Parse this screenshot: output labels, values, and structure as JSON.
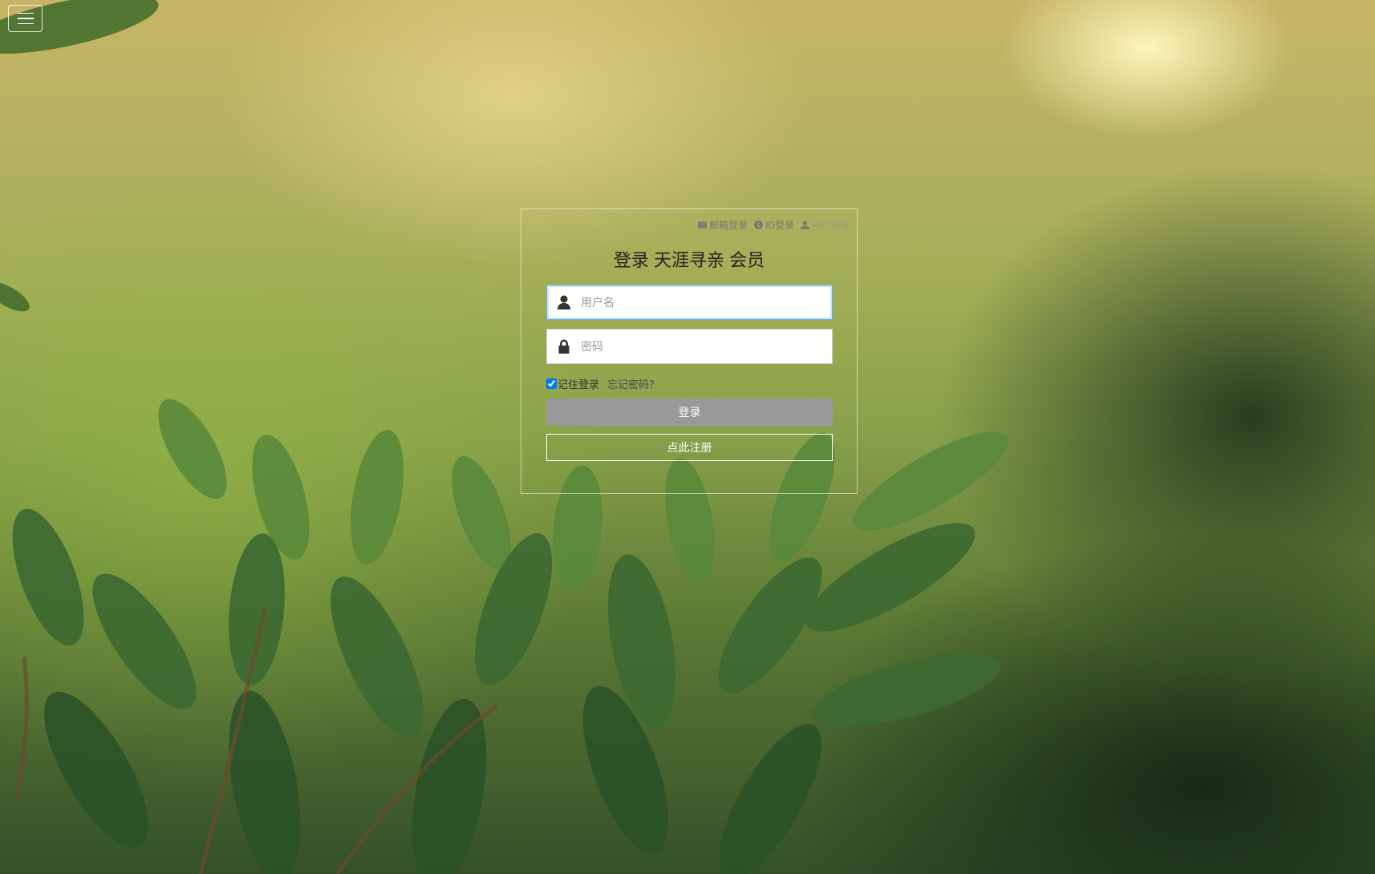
{
  "nav": {
    "menu_icon": "hamburger-menu-icon"
  },
  "login": {
    "tabs": [
      {
        "icon": "envelope-icon",
        "label": "邮箱登录"
      },
      {
        "icon": "info-circle-icon",
        "label": "ID登录"
      },
      {
        "icon": "user-icon",
        "label": "用户登录"
      }
    ],
    "title": "登录 天涯寻亲 会员",
    "username": {
      "placeholder": "用户名",
      "value": "",
      "icon": "user-icon"
    },
    "password": {
      "placeholder": "密码",
      "value": "",
      "icon": "lock-icon"
    },
    "remember_label": "记住登录",
    "remember_checked": true,
    "forgot_label": "忘记密码？",
    "login_button": "登录",
    "register_button": "点此注册"
  },
  "colors": {
    "login_button_bg": "#999999",
    "focus_border": "#66afe9"
  }
}
